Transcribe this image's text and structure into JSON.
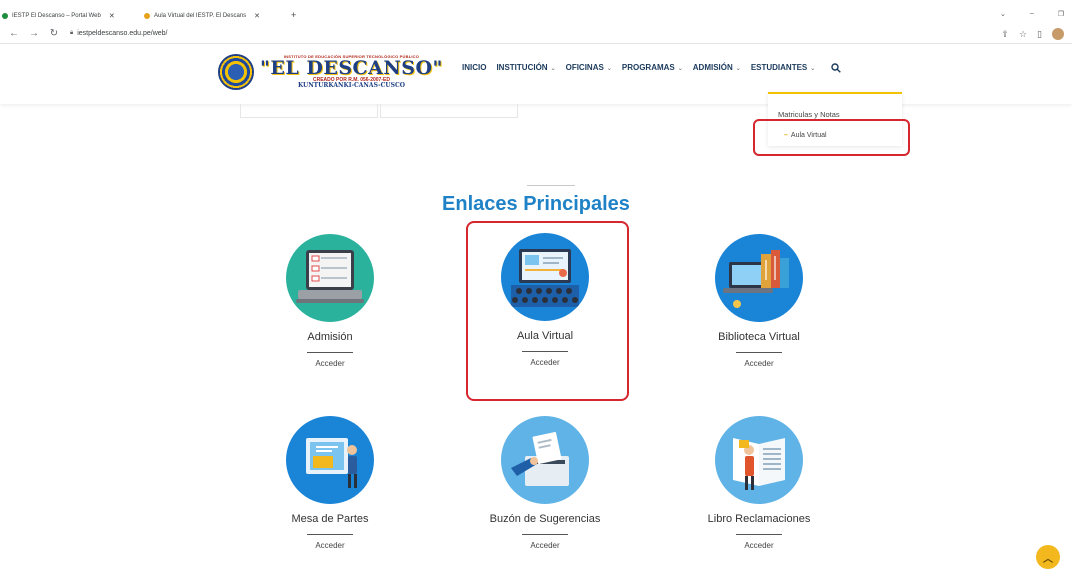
{
  "browser": {
    "tabs": [
      {
        "title": "IESTP El Descanso – Portal Web",
        "favicon_color": "#1e8e3e"
      },
      {
        "title": "Aula Virtual del IESTP. El Descans",
        "favicon_color": "#e6a21b"
      }
    ],
    "url": "iestpeldescanso.edu.pe/web/"
  },
  "logo": {
    "line1": "INSTITUTO DE EDUCACIÓN SUPERIOR TECNOLÓGICO PÚBLICO",
    "name": "\"EL DESCANSO\"",
    "decree": "CREADO POR R.M. 056-2007-ED",
    "place": "KUNTURKANKI-CANAS-CUSCO"
  },
  "menu": {
    "inicio": "INICIO",
    "institucion": "INSTITUCIÓN",
    "oficinas": "OFICINAS",
    "programas": "PROGRAMAS",
    "admision": "ADMISIÓN",
    "estudiantes": "ESTUDIANTES"
  },
  "dropdown": {
    "item1": "Matriculas y Notas",
    "item2": "Aula Virtual"
  },
  "section": {
    "title": "Enlaces Principales"
  },
  "cards": [
    {
      "label": "Admisión",
      "action": "Acceder"
    },
    {
      "label": "Aula Virtual",
      "action": "Acceder"
    },
    {
      "label": "Biblioteca Virtual",
      "action": "Acceder"
    },
    {
      "label": "Mesa de Partes",
      "action": "Acceder"
    },
    {
      "label": "Buzón de Sugerencias",
      "action": "Acceder"
    },
    {
      "label": "Libro Reclamaciones",
      "action": "Acceder"
    }
  ],
  "colors": {
    "accent": "#1f82c6",
    "highlight": "#d6262e",
    "dropdown_border": "#f2c200"
  }
}
